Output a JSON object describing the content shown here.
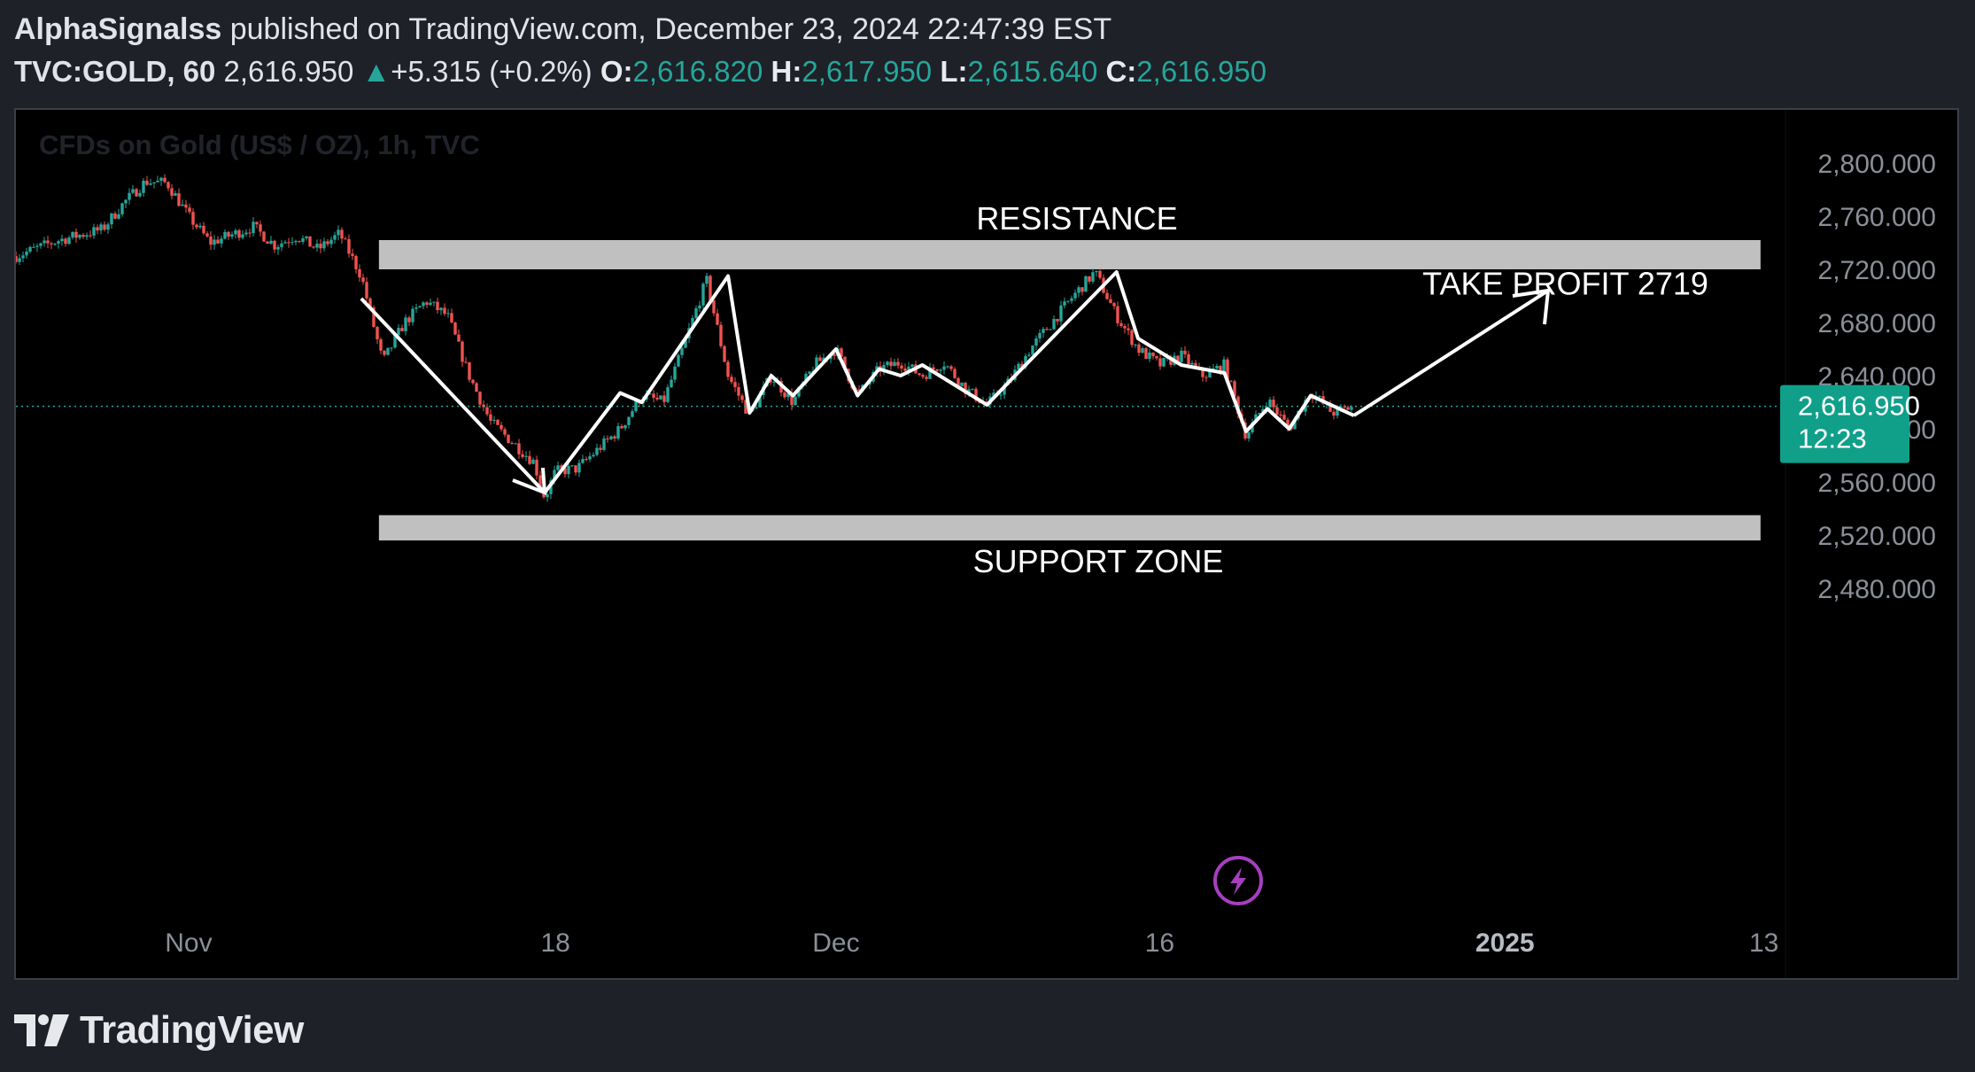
{
  "header": {
    "author": "AlphaSignalss",
    "published_text": "published on TradingView.com, December 23, 2024 22:47:39 EST",
    "symbol": "TVC:GOLD, 60",
    "last_price": "2,616.950",
    "change": "+5.315 (+0.2%)",
    "open_label": "O:",
    "open": "2,616.820",
    "high_label": "H:",
    "high": "2,617.950",
    "low_label": "L:",
    "low": "2,615.640",
    "close_label": "C:",
    "close": "2,616.950"
  },
  "colors": {
    "up": "#26a69a",
    "down": "#ef5350",
    "zone": "#c0c0c0",
    "axis_text": "#8a8f98",
    "price_tag": "#10a08a"
  },
  "chart_data": {
    "type": "candlestick",
    "title": "CFDs on Gold (US$ / OZ), 1h, TVC",
    "ylim": [
      2455,
      2810
    ],
    "y_ticks": [
      2800,
      2760,
      2720,
      2680,
      2640,
      2600,
      2560,
      2520,
      2480
    ],
    "y_tick_labels": [
      "2,800.000",
      "2,760.000",
      "2,720.000",
      "2,680.000",
      "2,640.000",
      "2,600.000",
      "2,560.000",
      "2,520.000",
      "2,480.000"
    ],
    "x_tick_labels": [
      {
        "label": "Nov",
        "date": "2024-11-01"
      },
      {
        "label": "18",
        "date": "2024-11-18"
      },
      {
        "label": "Dec",
        "date": "2024-12-01"
      },
      {
        "label": "16",
        "date": "2024-12-16"
      },
      {
        "label": "2025",
        "date": "2025-01-01",
        "bold": true
      },
      {
        "label": "13",
        "date": "2025-01-13"
      }
    ],
    "xlim": [
      "2024-10-24",
      "2025-01-14"
    ],
    "price_series": [
      {
        "date": "2024-10-24",
        "price": 2730
      },
      {
        "date": "2024-10-26",
        "price": 2742
      },
      {
        "date": "2024-10-28",
        "price": 2750
      },
      {
        "date": "2024-10-29",
        "price": 2770
      },
      {
        "date": "2024-10-30",
        "price": 2786
      },
      {
        "date": "2024-10-31",
        "price": 2785
      },
      {
        "date": "2024-11-01",
        "price": 2760
      },
      {
        "date": "2024-11-02",
        "price": 2740
      },
      {
        "date": "2024-11-04",
        "price": 2752
      },
      {
        "date": "2024-11-05",
        "price": 2738
      },
      {
        "date": "2024-11-06",
        "price": 2745
      },
      {
        "date": "2024-11-07",
        "price": 2735
      },
      {
        "date": "2024-11-08",
        "price": 2747
      },
      {
        "date": "2024-11-09",
        "price": 2715
      },
      {
        "date": "2024-11-10",
        "price": 2650
      },
      {
        "date": "2024-11-11",
        "price": 2680
      },
      {
        "date": "2024-11-12",
        "price": 2696
      },
      {
        "date": "2024-11-13",
        "price": 2685
      },
      {
        "date": "2024-11-14",
        "price": 2640
      },
      {
        "date": "2024-11-15",
        "price": 2605
      },
      {
        "date": "2024-11-16",
        "price": 2590
      },
      {
        "date": "2024-11-17",
        "price": 2575
      },
      {
        "date": "2024-11-17.5",
        "price": 2548
      },
      {
        "date": "2024-11-18",
        "price": 2568
      },
      {
        "date": "2024-11-19",
        "price": 2570
      },
      {
        "date": "2024-11-20",
        "price": 2585
      },
      {
        "date": "2024-11-21",
        "price": 2600
      },
      {
        "date": "2024-11-22",
        "price": 2625
      },
      {
        "date": "2024-11-23",
        "price": 2620
      },
      {
        "date": "2024-11-24",
        "price": 2665
      },
      {
        "date": "2024-11-25",
        "price": 2712
      },
      {
        "date": "2024-11-26",
        "price": 2640
      },
      {
        "date": "2024-11-27",
        "price": 2610
      },
      {
        "date": "2024-11-28",
        "price": 2640
      },
      {
        "date": "2024-11-29",
        "price": 2620
      },
      {
        "date": "2024-11-30",
        "price": 2648
      },
      {
        "date": "2024-12-01",
        "price": 2660
      },
      {
        "date": "2024-12-02",
        "price": 2625
      },
      {
        "date": "2024-12-03",
        "price": 2645
      },
      {
        "date": "2024-12-04",
        "price": 2650
      },
      {
        "date": "2024-12-05",
        "price": 2640
      },
      {
        "date": "2024-12-06",
        "price": 2650
      },
      {
        "date": "2024-12-07",
        "price": 2630
      },
      {
        "date": "2024-12-08",
        "price": 2618
      },
      {
        "date": "2024-12-09",
        "price": 2635
      },
      {
        "date": "2024-12-10",
        "price": 2660
      },
      {
        "date": "2024-12-11",
        "price": 2680
      },
      {
        "date": "2024-12-12",
        "price": 2700
      },
      {
        "date": "2024-12-13",
        "price": 2718
      },
      {
        "date": "2024-12-14",
        "price": 2685
      },
      {
        "date": "2024-12-15",
        "price": 2660
      },
      {
        "date": "2024-12-16",
        "price": 2648
      },
      {
        "date": "2024-12-17",
        "price": 2655
      },
      {
        "date": "2024-12-18",
        "price": 2640
      },
      {
        "date": "2024-12-19",
        "price": 2648
      },
      {
        "date": "2024-12-20",
        "price": 2595
      },
      {
        "date": "2024-12-21",
        "price": 2622
      },
      {
        "date": "2024-12-22",
        "price": 2600
      },
      {
        "date": "2024-12-23",
        "price": 2628
      },
      {
        "date": "2024-12-24",
        "price": 2612
      },
      {
        "date": "2024-12-25",
        "price": 2617
      }
    ],
    "zigzag_path": [
      {
        "date": "2024-11-09",
        "price": 2698
      },
      {
        "date": "2024-11-17.5",
        "price": 2552
      },
      {
        "date": "2024-11-21",
        "price": 2627
      },
      {
        "date": "2024-11-22",
        "price": 2620
      },
      {
        "date": "2024-11-26",
        "price": 2715
      },
      {
        "date": "2024-11-27",
        "price": 2612
      },
      {
        "date": "2024-11-28",
        "price": 2640
      },
      {
        "date": "2024-11-29",
        "price": 2625
      },
      {
        "date": "2024-12-01",
        "price": 2660
      },
      {
        "date": "2024-12-02",
        "price": 2625
      },
      {
        "date": "2024-12-03",
        "price": 2645
      },
      {
        "date": "2024-12-04",
        "price": 2640
      },
      {
        "date": "2024-12-05",
        "price": 2648
      },
      {
        "date": "2024-12-08",
        "price": 2618
      },
      {
        "date": "2024-12-09",
        "price": 2635
      },
      {
        "date": "2024-12-14",
        "price": 2718
      },
      {
        "date": "2024-12-15",
        "price": 2668
      },
      {
        "date": "2024-12-17",
        "price": 2648
      },
      {
        "date": "2024-12-18",
        "price": 2645
      },
      {
        "date": "2024-12-19",
        "price": 2642
      },
      {
        "date": "2024-12-20",
        "price": 2598
      },
      {
        "date": "2024-12-21",
        "price": 2615
      },
      {
        "date": "2024-12-22",
        "price": 2600
      },
      {
        "date": "2024-12-23",
        "price": 2625
      },
      {
        "date": "2024-12-25",
        "price": 2610
      }
    ],
    "projection": {
      "from": {
        "date": "2024-12-25",
        "price": 2610
      },
      "to": {
        "date": "2025-01-03",
        "price": 2704
      }
    },
    "zones": [
      {
        "name": "resistance",
        "label": "RESISTANCE",
        "from": 2720,
        "to": 2742,
        "start": "2024-11-09",
        "end": "2025-01-14"
      },
      {
        "name": "support",
        "label": "SUPPORT ZONE",
        "from": 2516,
        "to": 2535,
        "start": "2024-11-09",
        "end": "2025-01-14"
      }
    ],
    "annotations": [
      {
        "text": "TAKE PROFIT 2719",
        "date": "2024-12-29",
        "price": 2705
      }
    ],
    "current_price": {
      "value": 2616.95,
      "label": "2,616.950",
      "countdown": "12:23"
    },
    "legend": "none",
    "grid": false
  }
}
